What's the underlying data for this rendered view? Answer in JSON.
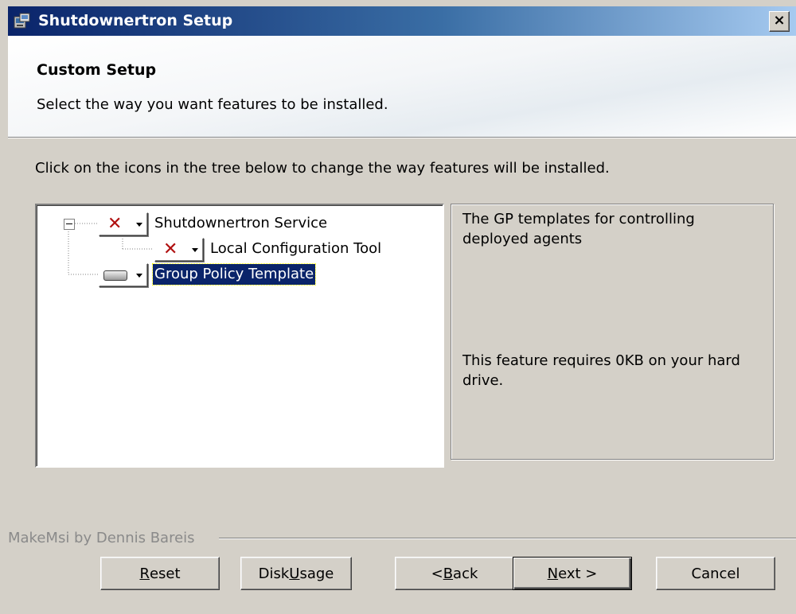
{
  "window": {
    "title": "Shutdownertron Setup",
    "close_glyph": "×"
  },
  "banner": {
    "title": "Custom Setup",
    "description": "Select the way you want features to be installed."
  },
  "instruction": "Click on the icons in the tree below to change the way features will be installed.",
  "tree": {
    "items": [
      {
        "label": "Shutdownertron Service",
        "state_icon": "x-unavailable-icon",
        "level": 0,
        "expanded": true
      },
      {
        "label": "Local Configuration Tool",
        "state_icon": "x-unavailable-icon",
        "level": 1
      },
      {
        "label": "Group Policy Template",
        "state_icon": "hard-drive-icon",
        "level": 0,
        "selected": true
      }
    ],
    "x_glyph": "✕"
  },
  "feature_description": {
    "text": "The GP templates for controlling deployed agents",
    "size_note": "This feature requires 0KB on your hard drive."
  },
  "footer": {
    "brand": "MakeMsi by Dennis Bareis",
    "buttons": {
      "reset": {
        "prefix": "",
        "mnemonic": "R",
        "suffix": "eset"
      },
      "disk_usage": {
        "prefix": "Disk ",
        "mnemonic": "U",
        "suffix": "sage"
      },
      "back": {
        "prefix": "< ",
        "mnemonic": "B",
        "suffix": "ack"
      },
      "next": {
        "prefix": "",
        "mnemonic": "N",
        "suffix": "ext >"
      },
      "cancel": {
        "prefix": "Cancel",
        "mnemonic": "",
        "suffix": ""
      }
    }
  },
  "colors": {
    "title_bar_start": "#0a246a",
    "title_bar_end": "#a6caf0",
    "selection": "#0a246a",
    "unavailable_x": "#b01010",
    "dialog_face": "#d4d0c8"
  }
}
